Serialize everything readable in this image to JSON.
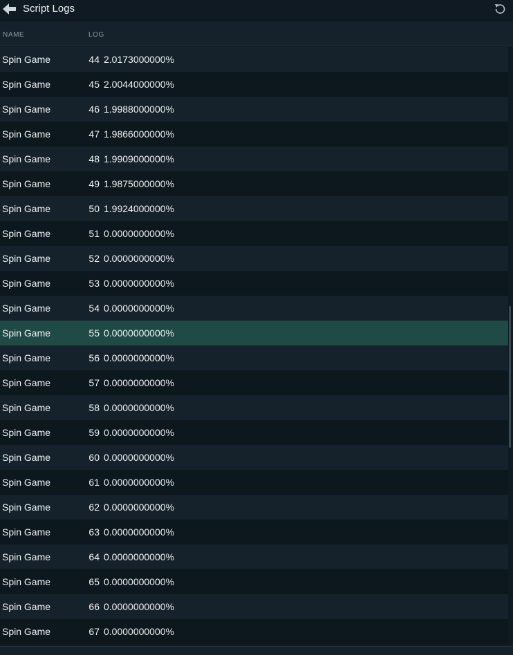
{
  "header": {
    "title": "Script Logs",
    "back_icon": "arrow-left-icon",
    "refresh_icon": "refresh-icon"
  },
  "columns": {
    "name": "NAME",
    "log": "LOG"
  },
  "selected_row_index": 11,
  "colors": {
    "selected_row": "#1f4a46",
    "row_odd": "#15222b",
    "row_even": "#0d171e"
  },
  "rows": [
    {
      "name": "Spin Game",
      "num": "44",
      "value": "2.0173000000%"
    },
    {
      "name": "Spin Game",
      "num": "45",
      "value": "2.0044000000%"
    },
    {
      "name": "Spin Game",
      "num": "46",
      "value": "1.9988000000%"
    },
    {
      "name": "Spin Game",
      "num": "47",
      "value": "1.9866000000%"
    },
    {
      "name": "Spin Game",
      "num": "48",
      "value": "1.9909000000%"
    },
    {
      "name": "Spin Game",
      "num": "49",
      "value": "1.9875000000%"
    },
    {
      "name": "Spin Game",
      "num": "50",
      "value": "1.9924000000%"
    },
    {
      "name": "Spin Game",
      "num": "51",
      "value": "0.0000000000%"
    },
    {
      "name": "Spin Game",
      "num": "52",
      "value": "0.0000000000%"
    },
    {
      "name": "Spin Game",
      "num": "53",
      "value": "0.0000000000%"
    },
    {
      "name": "Spin Game",
      "num": "54",
      "value": "0.0000000000%"
    },
    {
      "name": "Spin Game",
      "num": "55",
      "value": "0.0000000000%"
    },
    {
      "name": "Spin Game",
      "num": "56",
      "value": "0.0000000000%"
    },
    {
      "name": "Spin Game",
      "num": "57",
      "value": "0.0000000000%"
    },
    {
      "name": "Spin Game",
      "num": "58",
      "value": "0.0000000000%"
    },
    {
      "name": "Spin Game",
      "num": "59",
      "value": "0.0000000000%"
    },
    {
      "name": "Spin Game",
      "num": "60",
      "value": "0.0000000000%"
    },
    {
      "name": "Spin Game",
      "num": "61",
      "value": "0.0000000000%"
    },
    {
      "name": "Spin Game",
      "num": "62",
      "value": "0.0000000000%"
    },
    {
      "name": "Spin Game",
      "num": "63",
      "value": "0.0000000000%"
    },
    {
      "name": "Spin Game",
      "num": "64",
      "value": "0.0000000000%"
    },
    {
      "name": "Spin Game",
      "num": "65",
      "value": "0.0000000000%"
    },
    {
      "name": "Spin Game",
      "num": "66",
      "value": "0.0000000000%"
    },
    {
      "name": "Spin Game",
      "num": "67",
      "value": "0.0000000000%"
    }
  ]
}
